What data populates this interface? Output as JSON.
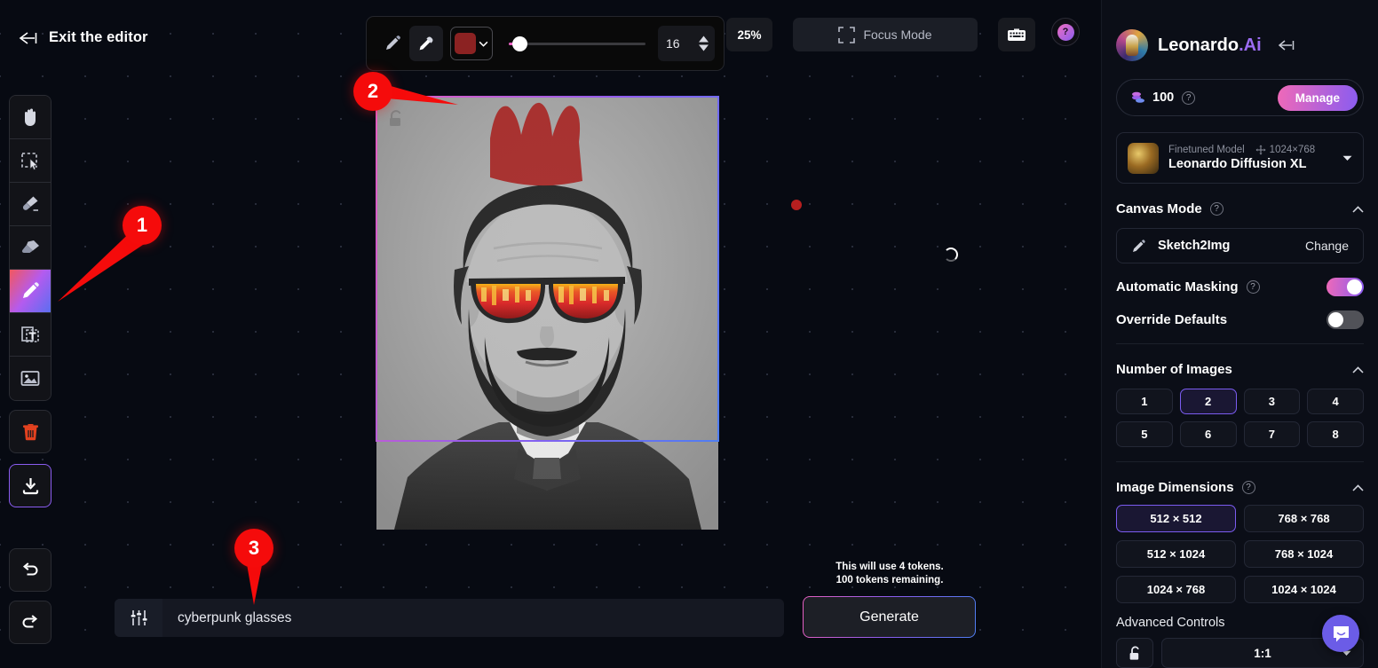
{
  "editor": {
    "exit_label": "Exit the editor",
    "zoom_level": "25%",
    "focus_mode_label": "Focus Mode",
    "brush_size": "16",
    "brush_color": "#8b2222",
    "accent_purple": "#8a5cf0",
    "accent_pink": "#e85fc0"
  },
  "tools": [
    {
      "name": "hand-tool",
      "title": "Pan"
    },
    {
      "name": "select-tool",
      "title": "Select"
    },
    {
      "name": "brush-tool",
      "title": "Brush"
    },
    {
      "name": "eraser-tool",
      "title": "Eraser"
    },
    {
      "name": "pencil-tool",
      "title": "Pencil"
    },
    {
      "name": "text-tool",
      "title": "Text"
    },
    {
      "name": "image-tool",
      "title": "Image"
    }
  ],
  "markers": [
    {
      "number": "1"
    },
    {
      "number": "2"
    },
    {
      "number": "3"
    }
  ],
  "prompt": {
    "value": "cyberpunk glasses",
    "placeholder": "cyberpunk glasses"
  },
  "generate": {
    "token_cost_text": "This will use 4 tokens.",
    "tokens_remaining_text": "100 tokens remaining.",
    "button_label": "Generate"
  },
  "panel": {
    "brand_main": "Leonardo",
    "brand_suffix": ".Ai",
    "credits": "100",
    "manage_label": "Manage",
    "model": {
      "type_label": "Finetuned Model",
      "resolution": "1024×768",
      "name": "Leonardo Diffusion XL"
    },
    "canvas_mode": {
      "title": "Canvas Mode",
      "mode_label": "Sketch2Img",
      "change_label": "Change"
    },
    "toggles": [
      {
        "label": "Automatic Masking",
        "state": "on",
        "has_help": true
      },
      {
        "label": "Override Defaults",
        "state": "off",
        "has_help": false
      }
    ],
    "number_of_images": {
      "title": "Number of Images",
      "options": [
        "1",
        "2",
        "3",
        "4",
        "5",
        "6",
        "7",
        "8"
      ],
      "selected": "2"
    },
    "image_dimensions": {
      "title": "Image Dimensions",
      "options": [
        "512 × 512",
        "768 × 768",
        "512 × 1024",
        "768 × 1024",
        "1024 × 768",
        "1024 × 1024"
      ],
      "selected": "512 × 512"
    },
    "advanced_controls": {
      "title": "Advanced Controls",
      "aspect_ratio": "1:1"
    }
  }
}
